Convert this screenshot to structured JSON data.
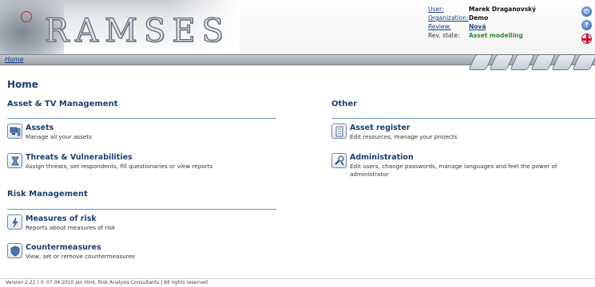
{
  "app": {
    "title": "RAMSES"
  },
  "user_info": {
    "user_label": "User:",
    "user_value": "Marek Draganovský",
    "organization_label": "Organization:",
    "organization_value": "Demo",
    "review_label": "Review:",
    "review_value": "Nová",
    "rev_state_label": "Rev. state:",
    "rev_state_value": "Asset modelling",
    "rev_state_color": "#2e8b2e"
  },
  "header_icons": [
    "power-icon",
    "help-icon",
    "uk-flag-icon"
  ],
  "breadcrumb": {
    "home": "Home"
  },
  "page": {
    "title": "Home"
  },
  "sections": {
    "asset_tv": {
      "title": "Asset & TV Management",
      "items": [
        {
          "title": "Assets",
          "desc": "Manage all your assets",
          "icon": "assets-icon"
        },
        {
          "title": "Threats & Vulnerabilities",
          "desc": "Assign threats, set respondents, fill questionaries or view reports",
          "icon": "threats-icon"
        }
      ]
    },
    "risk": {
      "title": "Risk Management",
      "items": [
        {
          "title": "Measures of risk",
          "desc": "Reports about measures of risk",
          "icon": "measures-icon"
        },
        {
          "title": "Countermeasures",
          "desc": "View, set or remove countermeasures",
          "icon": "countermeasures-icon"
        }
      ]
    },
    "other": {
      "title": "Other",
      "items": [
        {
          "title": "Asset register",
          "desc": "Edit resources, manage your projects",
          "icon": "register-icon"
        },
        {
          "title": "Administration",
          "desc": "Edit users, change passwords, manage languages and feel the power of administrator",
          "icon": "administration-icon"
        }
      ]
    }
  },
  "footer": {
    "text": "Version 2.22 | © 07.04.2010 Jan Hink, Risk Analysis Consultants | All rights reserved"
  },
  "colors": {
    "accent": "#1d3e73",
    "link": "#1a3f86",
    "rule": "#6c8fbf"
  }
}
